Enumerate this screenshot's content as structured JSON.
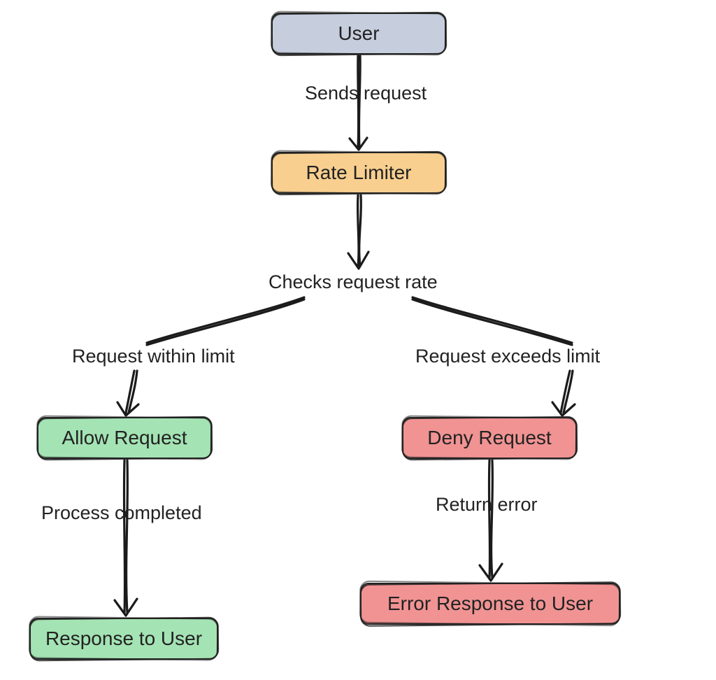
{
  "nodes": {
    "user": {
      "label": "User"
    },
    "rate_limiter": {
      "label": "Rate Limiter"
    },
    "allow": {
      "label": "Allow Request"
    },
    "deny": {
      "label": "Deny Request"
    },
    "response": {
      "label": "Response to User"
    },
    "error": {
      "label": "Error Response to User"
    }
  },
  "edges": {
    "sends_request": {
      "label": "Sends request"
    },
    "checks_request_rate": {
      "label": "Checks request rate"
    },
    "within_limit": {
      "label": "Request within limit"
    },
    "exceeds_limit": {
      "label": "Request exceeds limit"
    },
    "process_completed": {
      "label": "Process completed"
    },
    "return_error": {
      "label": "Return error"
    }
  },
  "colors": {
    "grey": "#c6cedd",
    "orange": "#f8cf8f",
    "green": "#a4e3b4",
    "red": "#f19393",
    "ink": "#1b1b1b"
  }
}
